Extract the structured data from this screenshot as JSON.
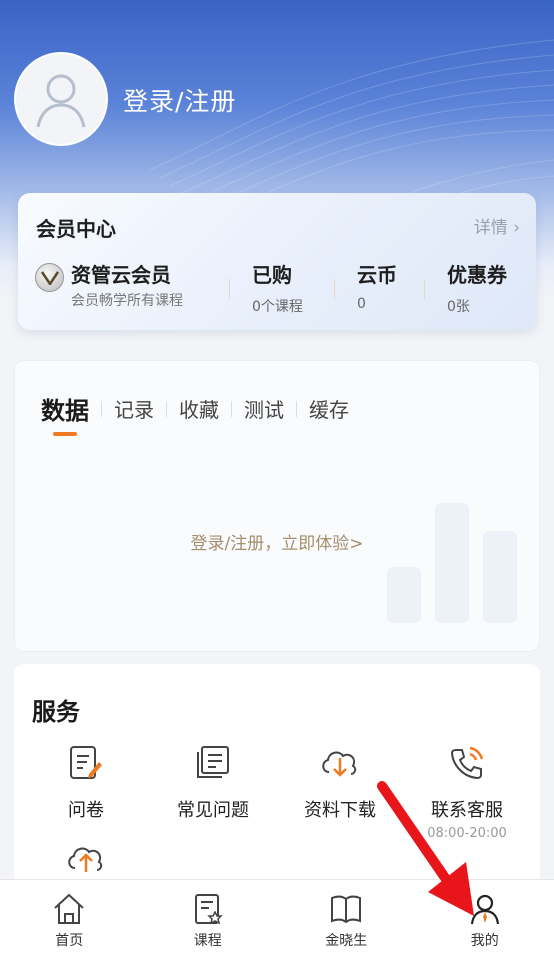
{
  "header": {
    "login_label": "登录/注册"
  },
  "member": {
    "title": "会员中心",
    "detail": "详情 ›",
    "vip_name": "资管云会员",
    "vip_sub": "会员畅学所有课程",
    "stats": [
      {
        "label": "已购",
        "value": "0个课程"
      },
      {
        "label": "云币",
        "value": "0"
      },
      {
        "label": "优惠券",
        "value": "0张"
      }
    ]
  },
  "data_tabs": [
    "数据",
    "记录",
    "收藏",
    "测试",
    "缓存"
  ],
  "data_cta": "登录/注册，立即体验>",
  "services": {
    "title": "服务",
    "items": [
      {
        "label": "问卷",
        "icon": "questionnaire-icon"
      },
      {
        "label": "常见问题",
        "icon": "faq-icon"
      },
      {
        "label": "资料下载",
        "icon": "download-icon"
      },
      {
        "label": "联系客服",
        "sub": "08:00-20:00",
        "icon": "phone-icon"
      },
      {
        "label": "",
        "icon": "cloud-upload-icon"
      }
    ]
  },
  "tabbar": [
    {
      "label": "首页",
      "icon": "home-icon"
    },
    {
      "label": "课程",
      "icon": "course-icon"
    },
    {
      "label": "金晓生",
      "icon": "book-icon"
    },
    {
      "label": "我的",
      "icon": "profile-icon",
      "active": true
    }
  ],
  "colors": {
    "accent": "#f07a22",
    "header_blue": "#3a63c6",
    "cta": "#a58e6c",
    "arrow": "#e8151a"
  }
}
